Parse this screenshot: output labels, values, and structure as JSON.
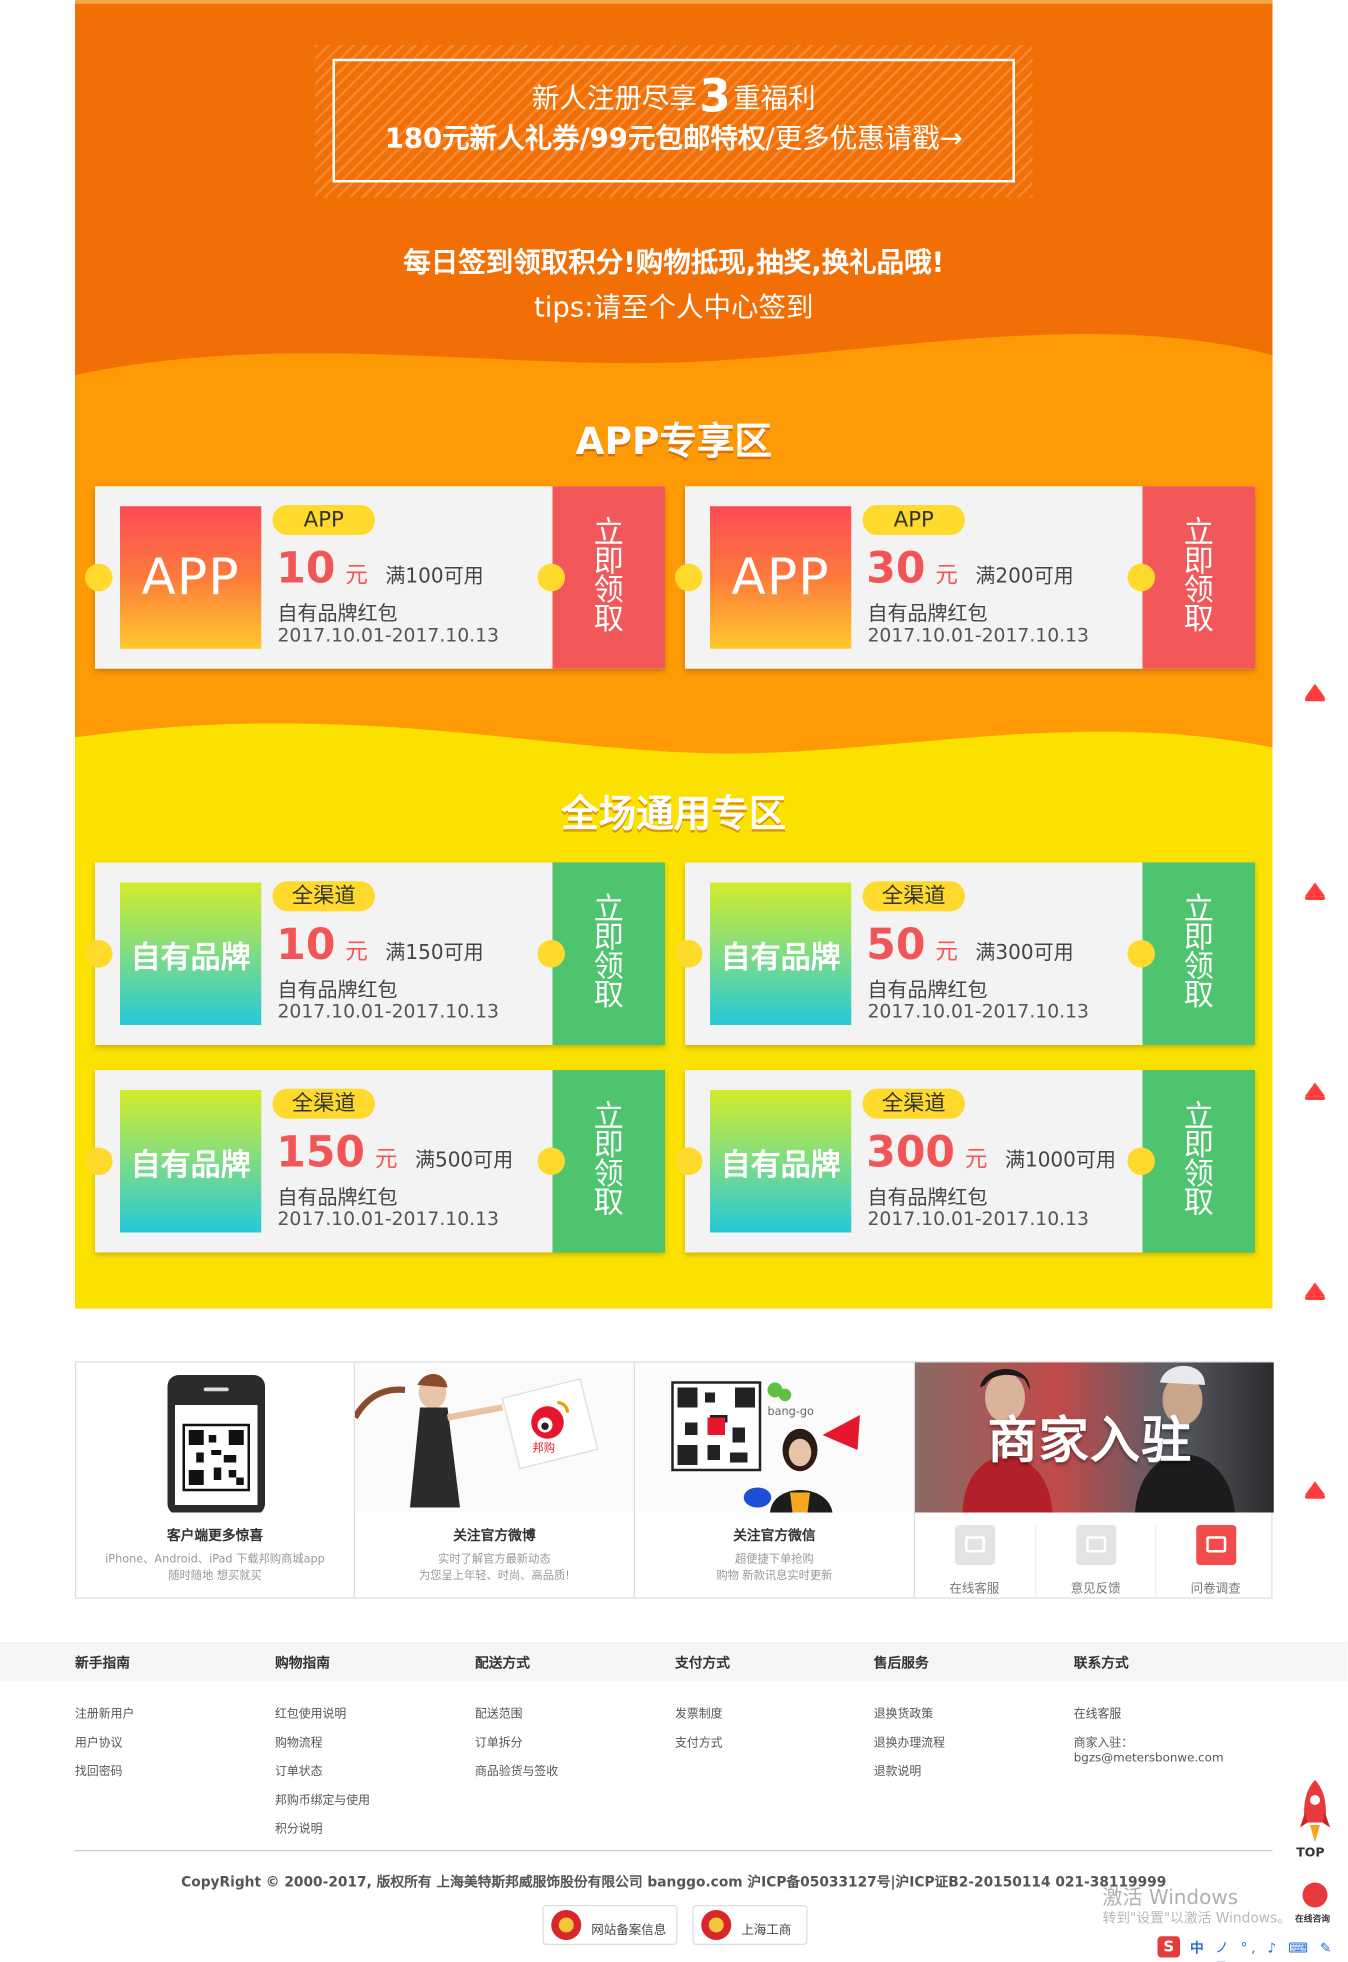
{
  "banner": {
    "line1_pre": "新人注册尽享",
    "line1_num": "3",
    "line1_post": "重福利",
    "line2_bold": "180元新人礼券/99元包邮特权",
    "line2_rest": "/更多优惠请戳→"
  },
  "daily": {
    "line1": "每日签到领取积分!购物抵现,抽奖,换礼品哦!",
    "line2": "tips:请至个人中心签到"
  },
  "app_section": {
    "title": "APP专享区",
    "coupons": [
      {
        "logo": "APP",
        "tag": "APP",
        "amount": "10",
        "unit": "元",
        "condition": "满100可用",
        "desc": "自有品牌红包",
        "date": "2017.10.01-2017.10.13",
        "action": "立即领取"
      },
      {
        "logo": "APP",
        "tag": "APP",
        "amount": "30",
        "unit": "元",
        "condition": "满200可用",
        "desc": "自有品牌红包",
        "date": "2017.10.01-2017.10.13",
        "action": "立即领取"
      }
    ]
  },
  "general_section": {
    "title": "全场通用专区",
    "coupons": [
      {
        "logo": "自有品牌",
        "tag": "全渠道",
        "amount": "10",
        "unit": "元",
        "condition": "满150可用",
        "desc": "自有品牌红包",
        "date": "2017.10.01-2017.10.13",
        "action": "立即领取"
      },
      {
        "logo": "自有品牌",
        "tag": "全渠道",
        "amount": "50",
        "unit": "元",
        "condition": "满300可用",
        "desc": "自有品牌红包",
        "date": "2017.10.01-2017.10.13",
        "action": "立即领取"
      },
      {
        "logo": "自有品牌",
        "tag": "全渠道",
        "amount": "150",
        "unit": "元",
        "condition": "满500可用",
        "desc": "自有品牌红包",
        "date": "2017.10.01-2017.10.13",
        "action": "立即领取"
      },
      {
        "logo": "自有品牌",
        "tag": "全渠道",
        "amount": "300",
        "unit": "元",
        "condition": "满1000可用",
        "desc": "自有品牌红包",
        "date": "2017.10.01-2017.10.13",
        "action": "立即领取"
      }
    ]
  },
  "strip": {
    "client": {
      "title": "客户端更多惊喜",
      "line1": "iPhone、Android、iPad 下载邦购商城app",
      "line2": "随时随地 想买就买"
    },
    "weibo": {
      "title": "关注官方微博",
      "line1": "实时了解官方最新动态",
      "line2": "为您呈上年轻、时尚、高品质!",
      "badge": "邦购"
    },
    "weixin": {
      "title": "关注官方微信",
      "line1": "超便捷下单抢购",
      "line2": "购物 新款讯息实时更新",
      "brand": "bang-go"
    },
    "merchant": {
      "title": "商家入驻"
    },
    "services": [
      {
        "label": "在线客服",
        "icon": "chat-icon"
      },
      {
        "label": "意见反馈",
        "icon": "mail-icon"
      },
      {
        "label": "问卷调查",
        "icon": "edit-icon"
      }
    ]
  },
  "footer": {
    "columns": [
      {
        "heading": "新手指南",
        "items": [
          "注册新用户",
          "用户协议",
          "找回密码"
        ]
      },
      {
        "heading": "购物指南",
        "items": [
          "红包使用说明",
          "购物流程",
          "订单状态",
          "邦购币绑定与使用",
          "积分说明"
        ]
      },
      {
        "heading": "配送方式",
        "items": [
          "配送范围",
          "订单拆分",
          "商品验货与签收"
        ]
      },
      {
        "heading": "支付方式",
        "items": [
          "发票制度",
          "支付方式"
        ]
      },
      {
        "heading": "售后服务",
        "items": [
          "退换货政策",
          "退换办理流程",
          "退款说明"
        ]
      },
      {
        "heading": "联系方式",
        "items": [
          "在线客服",
          "商家入驻：",
          "bgzs@metersbonwe.com"
        ]
      }
    ],
    "copyright": "CopyRight © 2000-2017, 版权所有 上海美特斯邦威服饰股份有限公司 banggo.com 沪ICP备05033127号|沪ICP证B2-20150114 021-38119999",
    "badges": [
      "网站备案信息",
      "上海工商"
    ]
  },
  "side": {
    "top_label": "TOP",
    "cs_label": "在线咨询"
  },
  "watermark": {
    "line1": "激活 Windows",
    "line2": "转到\"设置\"以激活 Windows。"
  },
  "ime": {
    "logo": "S",
    "lang": "中",
    "tray": "ノ °, ♪ ⌨ ✎ ⊞"
  },
  "colors": {
    "orange": "#f26f05",
    "orange2": "#fd9a06",
    "yellow": "#fbe100",
    "coupon_red": "#f25859",
    "coupon_green": "#4ec46e",
    "price_red": "#f25555"
  }
}
